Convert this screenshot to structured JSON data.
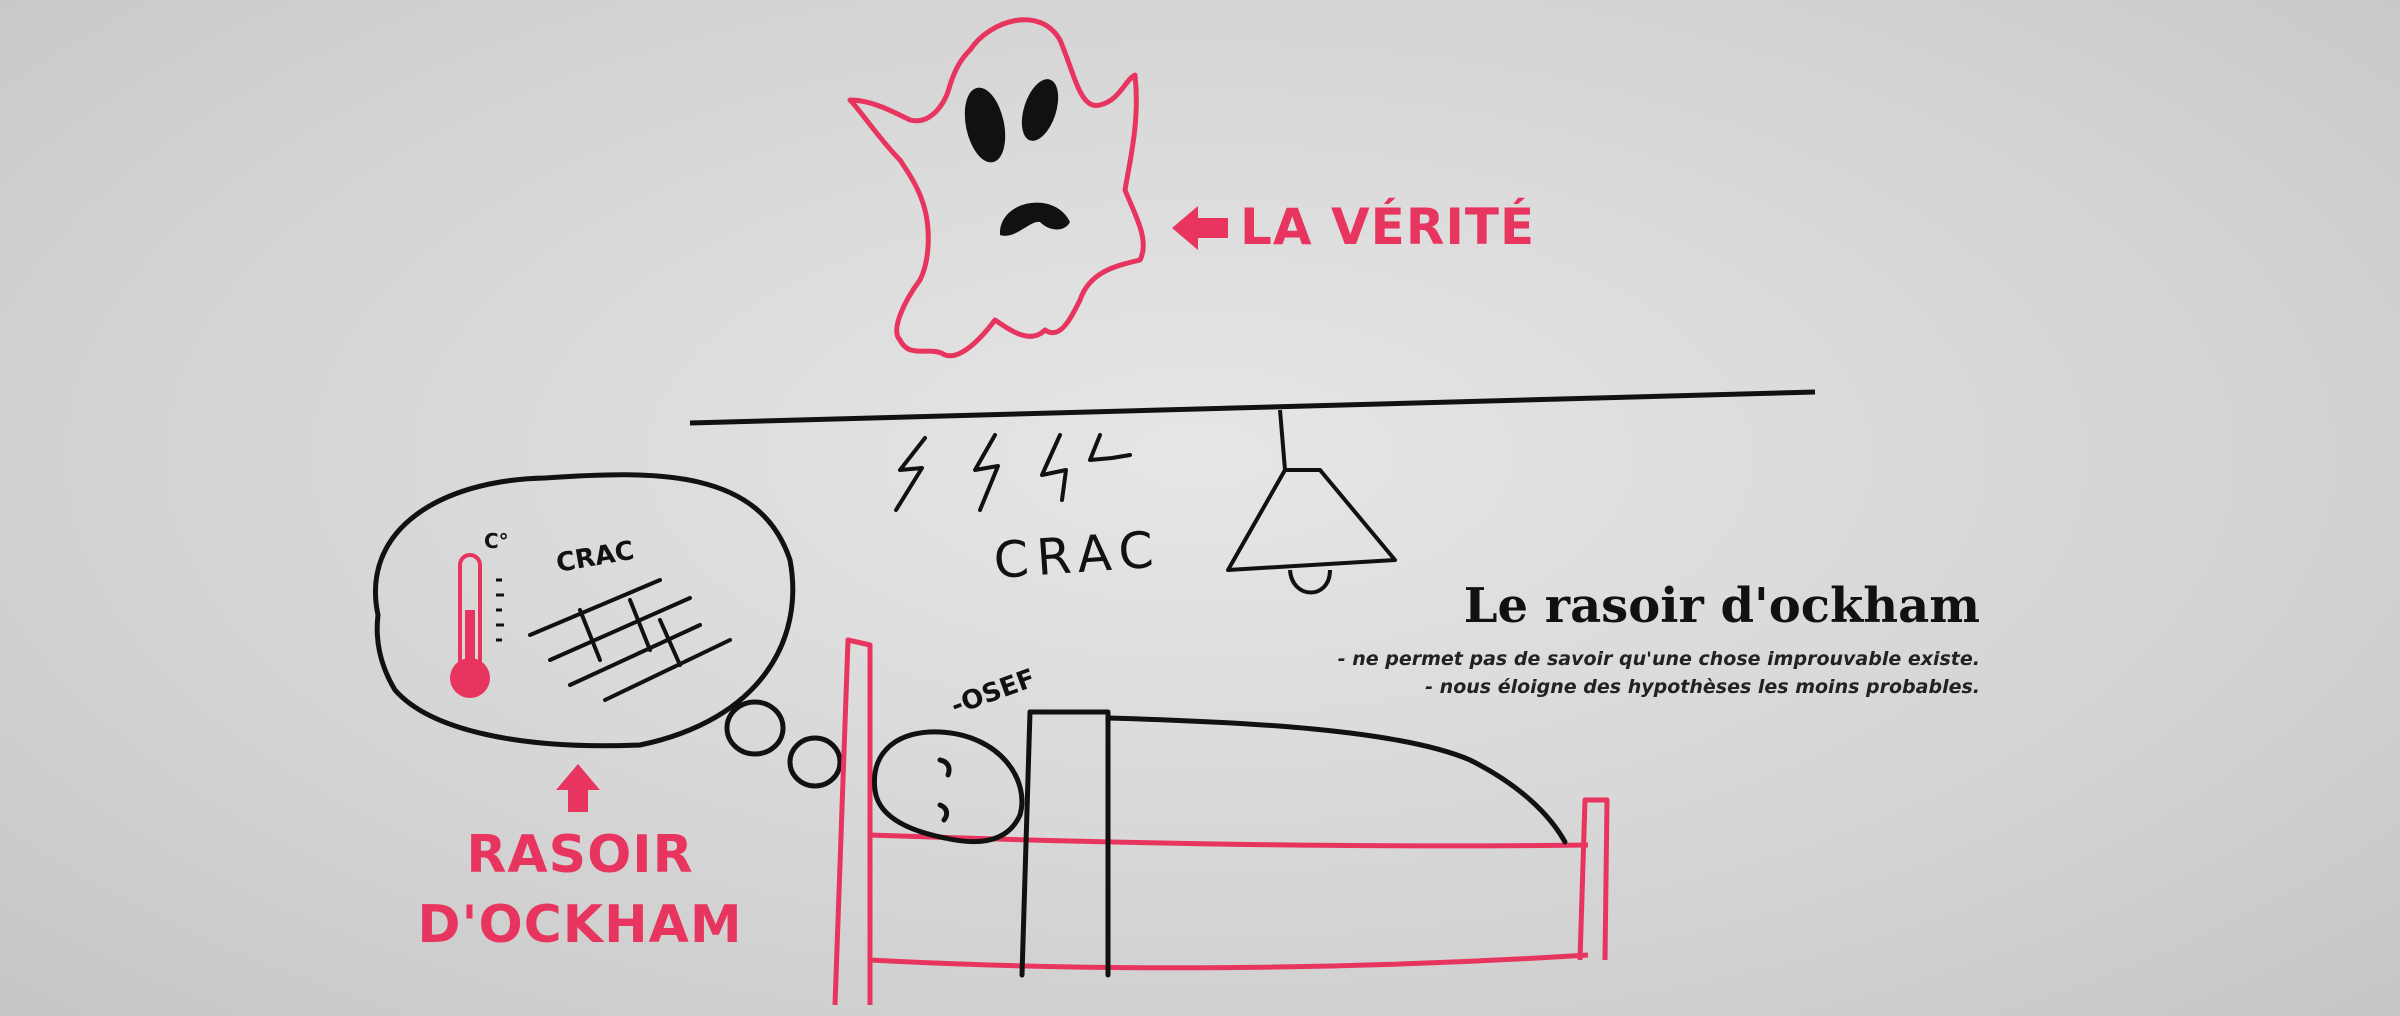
{
  "ghost_caption": "LA VÉRITÉ",
  "razor_caption": {
    "line1": "RASOIR",
    "line2": "D'OCKHAM"
  },
  "panel": {
    "title": "Le rasoir d'ockham",
    "points": [
      "- ne permet pas de savoir qu'une chose improuvable existe.",
      "- nous éloigne des hypothèses les moins probables."
    ]
  },
  "sound_effect": "CRAC",
  "thought_bubble": {
    "degree_mark": "C°",
    "crack_text": "CRAC"
  },
  "sleeper_remark": "-OSEF",
  "colors": {
    "accent_red": "#e8355f",
    "ink": "#111111",
    "chalkboard": "#d9d9d9"
  }
}
